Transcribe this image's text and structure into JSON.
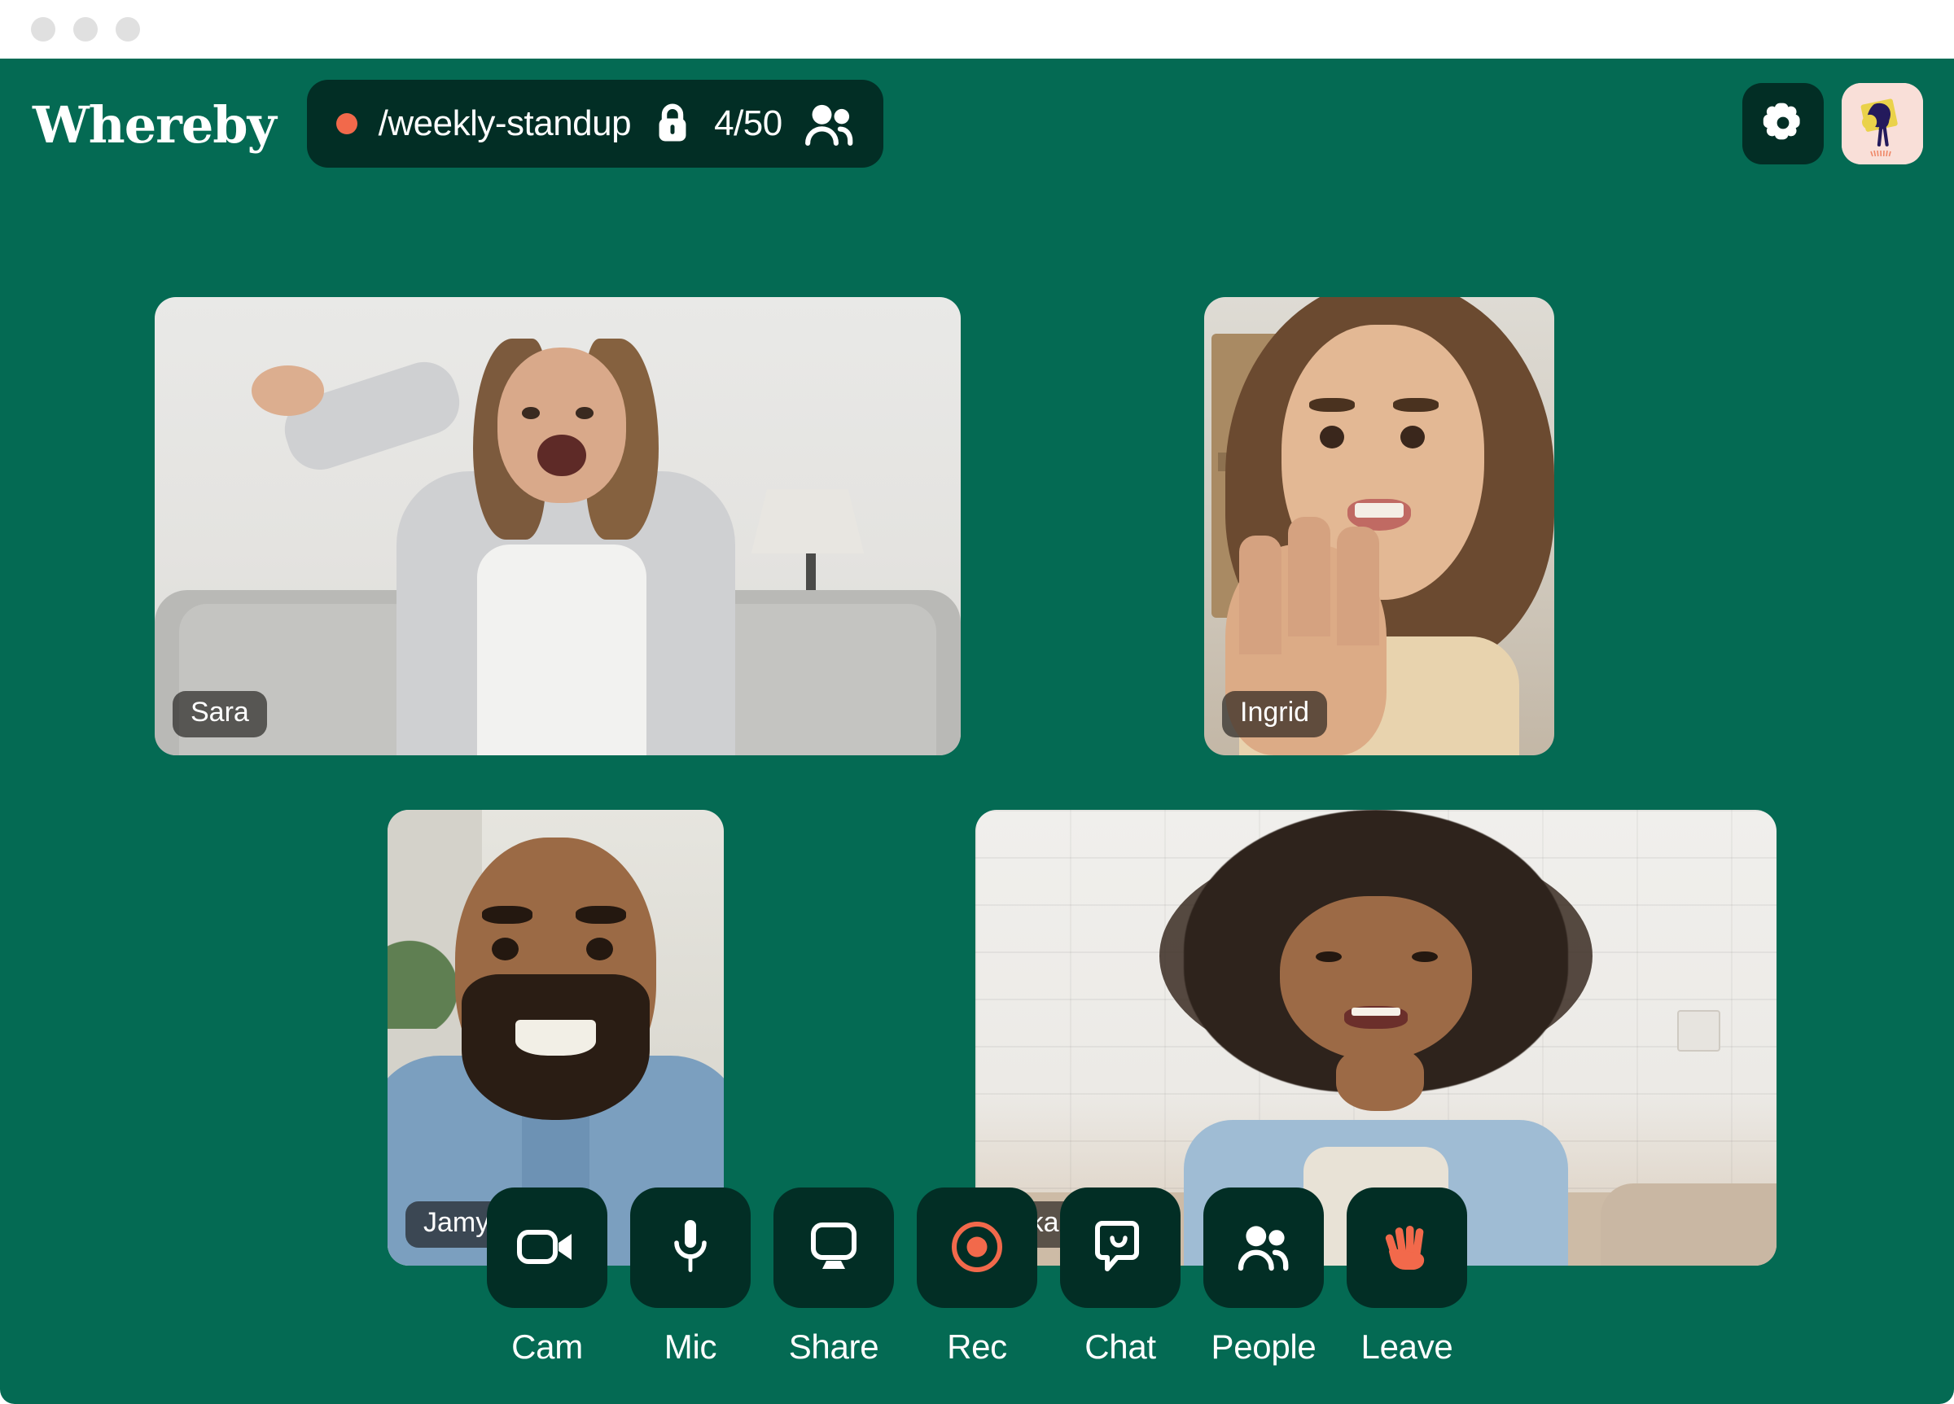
{
  "window": {
    "traffic_dots": [
      "close",
      "minimize",
      "maximize"
    ]
  },
  "header": {
    "brand": "Whereby",
    "room": {
      "recording_indicator": "recording-dot",
      "name": "/weekly-standup",
      "lock_icon": "lock-icon",
      "participant_count": "4/50",
      "people_icon": "people-icon"
    },
    "settings_label": "Settings",
    "settings_icon": "gear-icon",
    "avatar_label": "Profile",
    "avatar_icon": "avatar-illustration"
  },
  "participants": [
    {
      "id": "sara",
      "name": "Sara"
    },
    {
      "id": "ingrid",
      "name": "Ingrid"
    },
    {
      "id": "jamy",
      "name": "Jamy (You)"
    },
    {
      "id": "akari",
      "name": "Akari"
    }
  ],
  "toolbar": [
    {
      "id": "cam",
      "label": "Cam",
      "icon": "camera-icon",
      "active": false
    },
    {
      "id": "mic",
      "label": "Mic",
      "icon": "microphone-icon",
      "active": false
    },
    {
      "id": "share",
      "label": "Share",
      "icon": "screen-share-icon",
      "active": false
    },
    {
      "id": "rec",
      "label": "Rec",
      "icon": "record-icon",
      "active": true
    },
    {
      "id": "chat",
      "label": "Chat",
      "icon": "chat-bubble-icon",
      "active": false
    },
    {
      "id": "people",
      "label": "People",
      "icon": "people-icon",
      "active": false
    },
    {
      "id": "leave",
      "label": "Leave",
      "icon": "raised-hand-icon",
      "active": true
    }
  ],
  "colors": {
    "background_green": "#046a53",
    "panel_dark": "#022e25",
    "accent_coral": "#f2694b",
    "avatar_pink": "#f9dfd8",
    "text_white": "#ffffff",
    "titlebar_white": "#ffffff",
    "dot_grey": "#e0e0e0"
  }
}
